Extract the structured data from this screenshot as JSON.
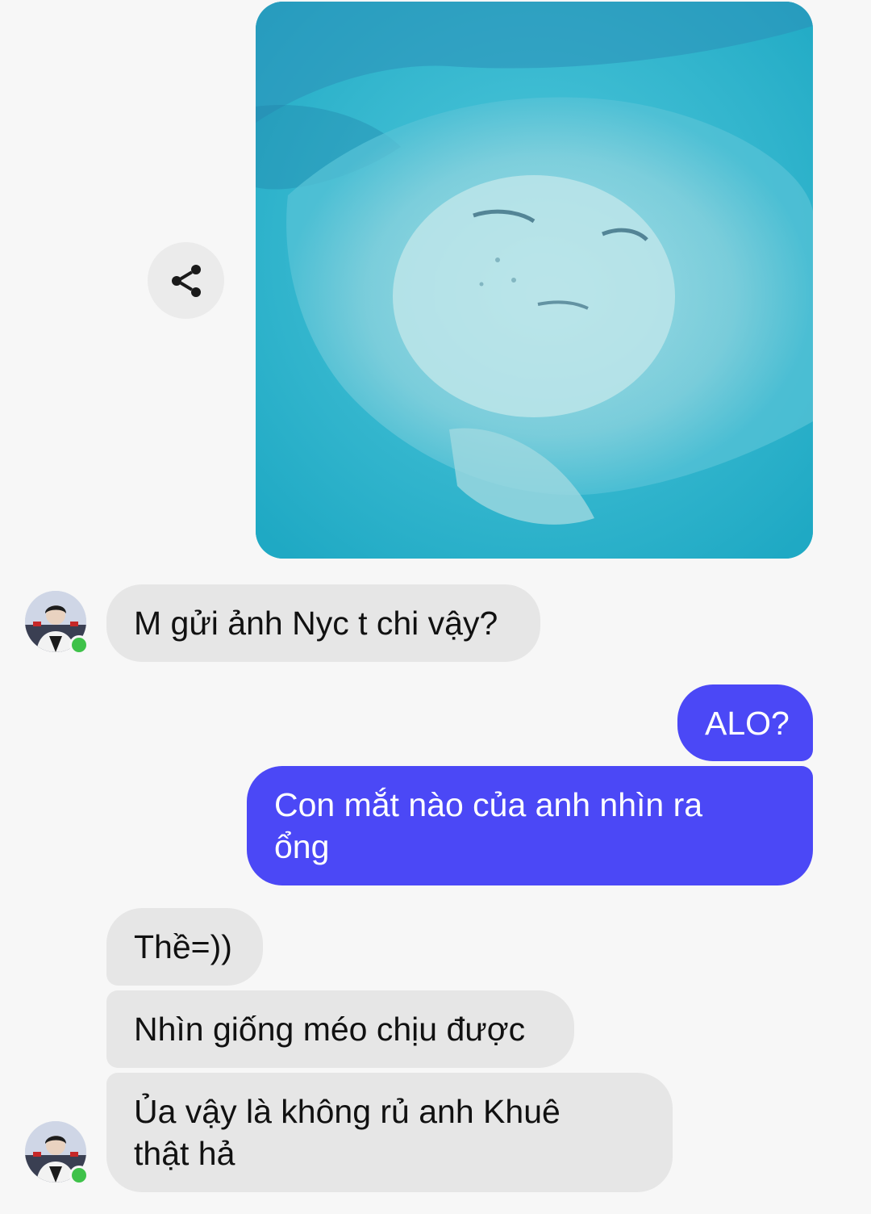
{
  "conversation": {
    "photo": {
      "description_icon": "photo-stingray",
      "tint": "#2db4cc"
    },
    "share_button": {
      "icon": "share-icon"
    },
    "messages": [
      {
        "direction": "incoming",
        "text": "M gửi ảnh Nyc t chi vậy?"
      },
      {
        "direction": "outgoing",
        "text": "ALO?"
      },
      {
        "direction": "outgoing",
        "line1": "Con mắt nào của anh nhìn ra",
        "line2": "ổng"
      },
      {
        "direction": "incoming",
        "text": "Thề=))"
      },
      {
        "direction": "incoming",
        "text": "Nhìn giống méo chịu được"
      },
      {
        "direction": "incoming",
        "line1": "Ủa vậy là không rủ anh Khuê",
        "line2": "thật hả"
      }
    ],
    "contact": {
      "status": "online",
      "status_color": "#3fc24a"
    }
  },
  "colors": {
    "outgoing_bubble": "#4b48f6",
    "incoming_bubble": "#e6e6e6",
    "background": "#f7f7f7"
  }
}
